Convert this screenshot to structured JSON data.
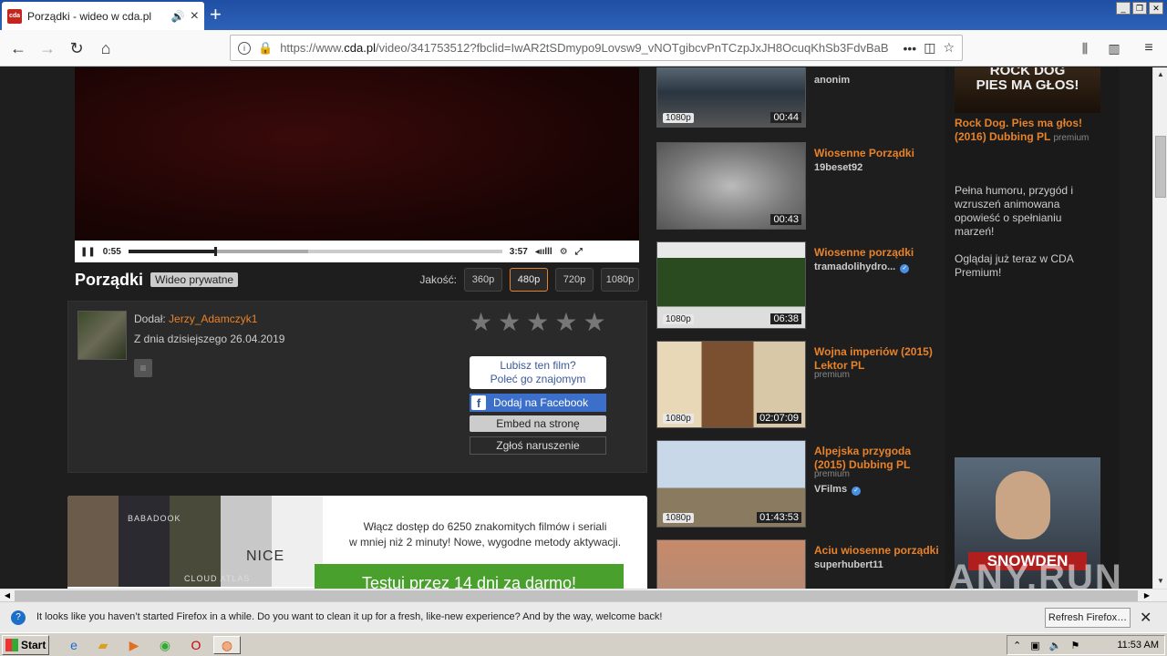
{
  "browser": {
    "tab_title": "Porządki - wideo w cda.pl",
    "favicon_text": "cda",
    "url_prefix": "https://www.",
    "url_domain": "cda.pl",
    "url_rest": "/video/341753512?fbclid=IwAR2tSDmypo9Lovsw9_vNOTgibcvPnTCzpJxJH8OcuqKhSb3FdvBaB"
  },
  "player": {
    "current_time": "0:55",
    "duration": "3:57",
    "progress_fraction": 0.23,
    "buffered_fraction": 0.48
  },
  "video": {
    "title": "Porządki",
    "privacy_badge": "Wideo prywatne",
    "quality_label": "Jakość:",
    "qualities": [
      "360p",
      "480p",
      "720p",
      "1080p"
    ],
    "selected_quality": "480p",
    "added_by_label": "Dodał:",
    "added_by_user": "Jerzy_Adamczyk1",
    "date_text": "Z dnia dzisiejszego 26.04.2019",
    "rating_stars": 5,
    "like_prompt_line1": "Lubisz ten film?",
    "like_prompt_line2": "Poleć go znajomym",
    "fb_button": "Dodaj na Facebook",
    "embed_button": "Embed na stronę",
    "report_button": "Zgłoś naruszenie"
  },
  "promo": {
    "line1": "Włącz dostęp do 6250 znakomitych filmów i seriali",
    "line2": "w mniej niż 2 minuty! Nowe, wygodne metody aktywacji.",
    "cta": "Testuj przez 14 dni za darmo!",
    "poster_texts": [
      "BABADOOK",
      "CLOUD ATLAS",
      "NICE"
    ]
  },
  "related": [
    {
      "title": "",
      "user": "anonim",
      "quality": "1080p",
      "duration": "00:44",
      "premium": "",
      "verified": false
    },
    {
      "title": "Wiosenne Porządki",
      "user": "19beset92",
      "quality": "",
      "duration": "00:43",
      "premium": "",
      "verified": false
    },
    {
      "title": "Wiosenne porządki",
      "user": "tramadolihydro...",
      "quality": "1080p",
      "duration": "06:38",
      "premium": "",
      "verified": true
    },
    {
      "title": "Wojna imperiów (2015) Lektor PL",
      "user": "",
      "quality": "1080p",
      "duration": "02:07:09",
      "premium": "premium",
      "verified": false
    },
    {
      "title": "Alpejska przygoda (2015) Dubbing PL",
      "user": "VFilms",
      "quality": "1080p",
      "duration": "01:43:53",
      "premium": "premium",
      "verified": true
    },
    {
      "title": "Aciu wiosenne porządki",
      "user": "superhubert11",
      "quality": "",
      "duration": "",
      "premium": "",
      "verified": false
    }
  ],
  "sidebar": {
    "poster_text_1": "ROCK DOG",
    "poster_text_2": "PIES MA GŁOS!",
    "title": "Rock Dog. Pies ma głos! (2016) Dubbing PL",
    "premium": "premium",
    "description": "Pełna humoru, przygód i wzruszeń animowana opowieść o spełnianiu marzeń!",
    "cta": "Oglądaj już teraz w CDA Premium!",
    "poster2_label": "SNOWDEN"
  },
  "notification": {
    "message": "It looks like you haven’t started Firefox in a while. Do you want to clean it up for a fresh, like-new experience? And by the way, welcome back!",
    "button": "Refresh Firefox…"
  },
  "taskbar": {
    "start": "Start",
    "clock": "11:53 AM"
  },
  "watermark": "ANY.RUN",
  "colors": {
    "accent": "#e8822a",
    "facebook": "#3b6fc9",
    "promo_green": "#4aa02c",
    "titlebar": "#2d62b8"
  }
}
